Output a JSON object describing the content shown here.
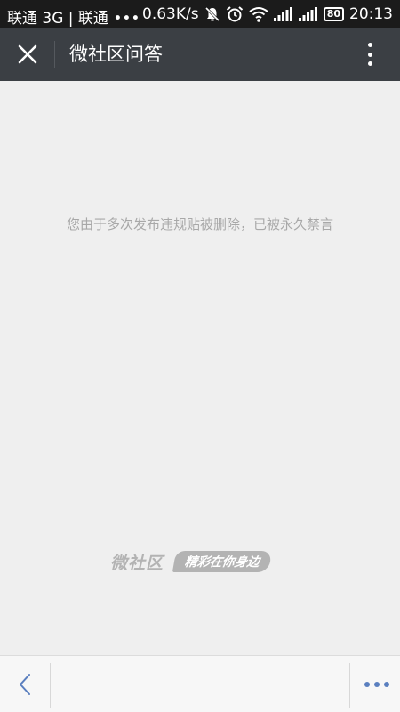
{
  "status_bar": {
    "carrier": "联通 3G | 联通 •••",
    "speed": "0.63K/s",
    "battery": "80",
    "time": "20:13",
    "icons": [
      "notification-off-icon",
      "alarm-icon",
      "wifi-icon",
      "signal-icon",
      "signal-icon",
      "battery-icon"
    ]
  },
  "app_bar": {
    "close_icon": "close-icon",
    "title": "微社区问答",
    "more_icon": "more-vertical-icon"
  },
  "content": {
    "notice": "您由于多次发布违规贴被删除，已被永久禁言",
    "brand_name": "微社区",
    "brand_tagline": "精彩在你身边"
  },
  "bottom_bar": {
    "back_icon": "chevron-left-icon",
    "menu_icon": "more-horizontal-icon",
    "accent_color": "#5a7fbf"
  }
}
